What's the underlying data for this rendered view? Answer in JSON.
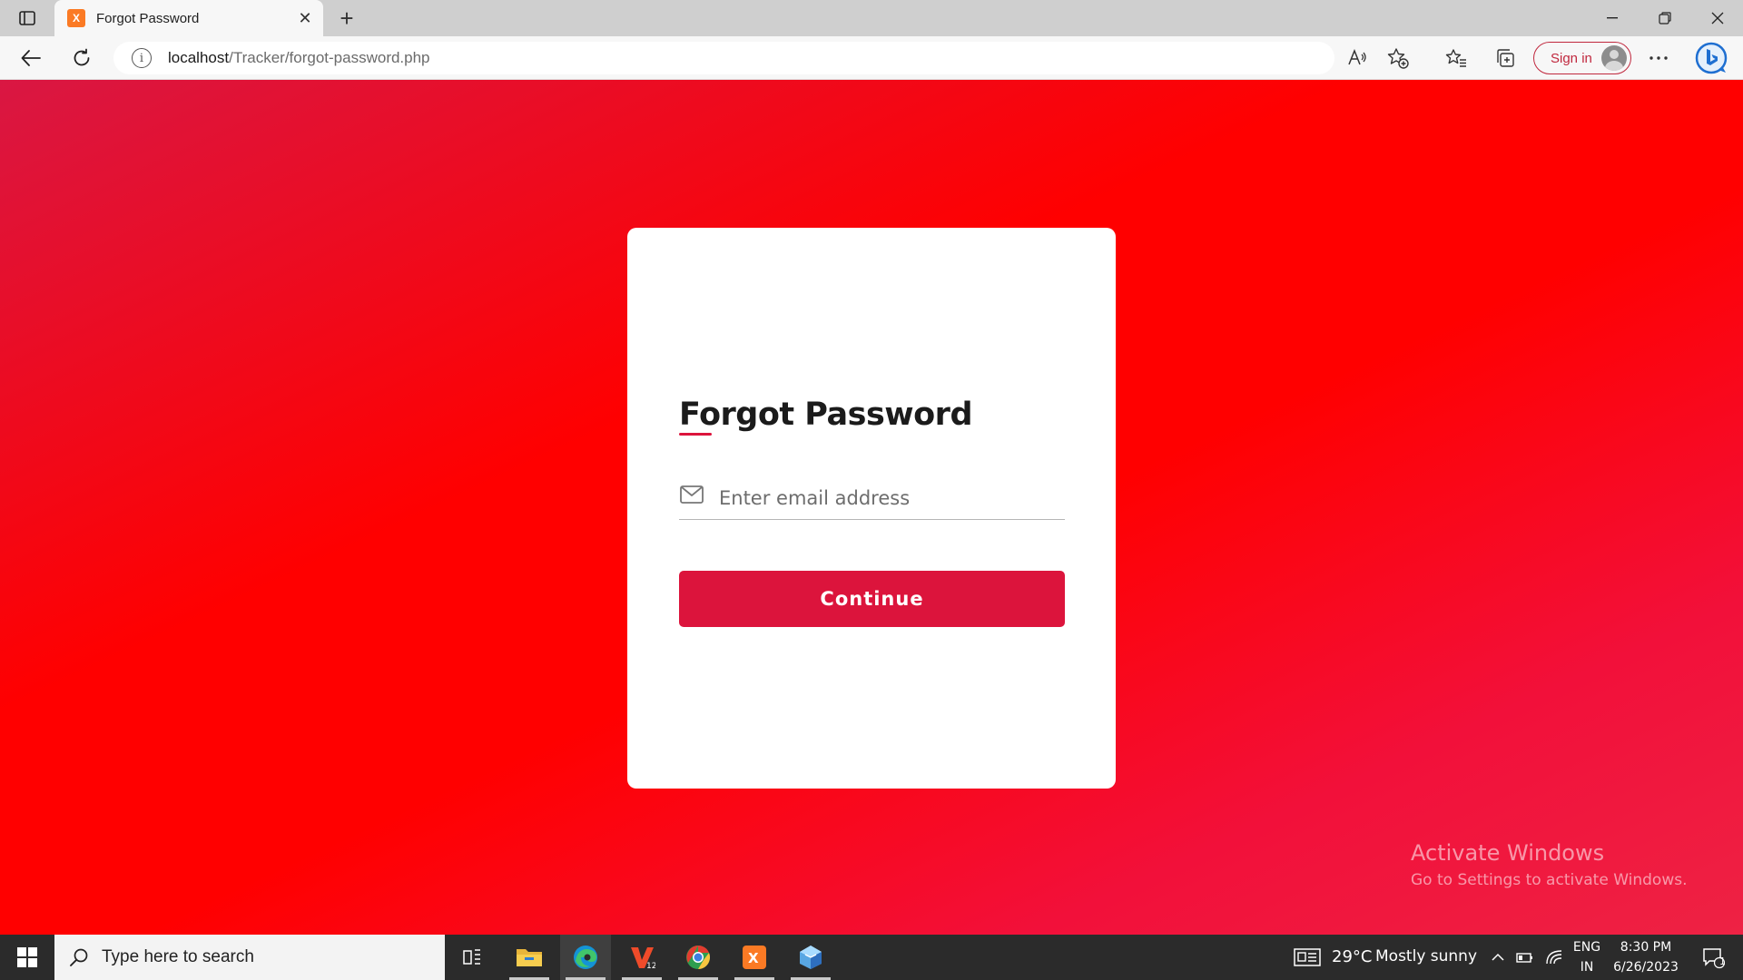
{
  "browser": {
    "tab_title": "Forgot Password",
    "tab_favicon_glyph": "X",
    "url_host": "localhost",
    "url_path": "/Tracker/forgot-password.php",
    "signin_label": "Sign in"
  },
  "form": {
    "title": "Forgot Password",
    "email_placeholder": "Enter email address",
    "continue_label": "Continue",
    "accent_color": "#dc143c"
  },
  "watermark": {
    "title": "Activate Windows",
    "subtitle": "Go to Settings to activate Windows."
  },
  "taskbar": {
    "search_placeholder": "Type here to search",
    "weather_temp": "29°C",
    "weather_desc": "Mostly sunny",
    "lang_top": "ENG",
    "lang_bottom": "IN",
    "time": "8:30 PM",
    "date": "6/26/2023",
    "notification_count": "1"
  }
}
